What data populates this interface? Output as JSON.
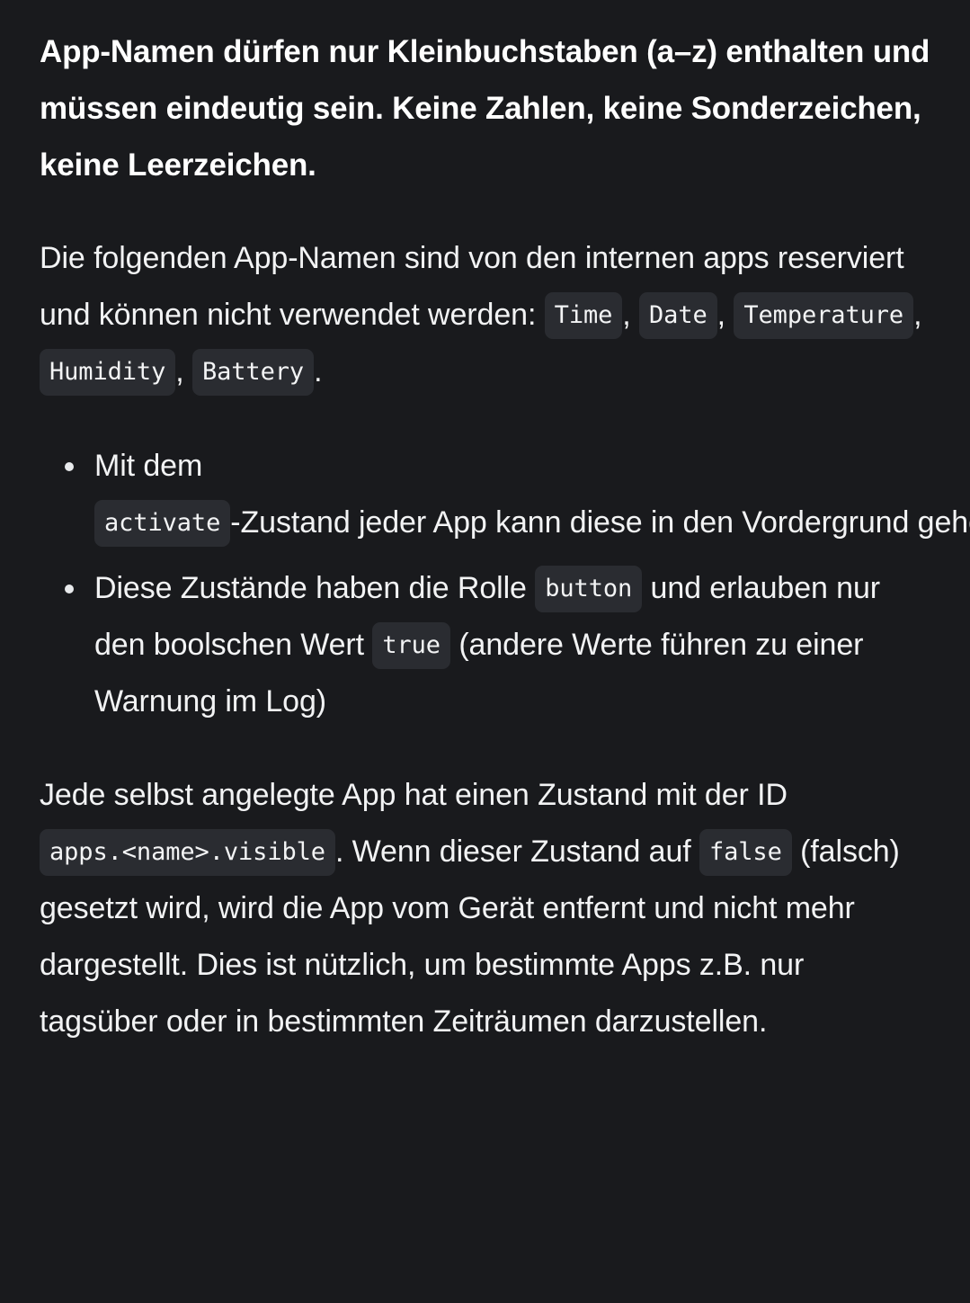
{
  "document": {
    "language": "de",
    "colors": {
      "background": "#191a1d",
      "text": "#f2f3f4",
      "heading_text": "#ffffff",
      "code_chip_background": "#2a2c31",
      "code_chip_text": "#f3f4f5",
      "bullet_marker": "#e8eaec"
    },
    "lead_paragraph": "App-Namen dürfen nur Kleinbuchstaben (a–z) enthalten und müssen eindeutig sein. Keine Zahlen, keine Sonderzeichen, keine Leerzeichen.",
    "reserved_paragraph": {
      "intro": "Die folgenden App-Namen sind von den internen apps reserviert und können nicht verwendet werden:",
      "reserved_names": [
        "Time",
        "Date",
        "Temperature",
        "Humidity",
        "Battery"
      ],
      "separator": ",",
      "terminator": "."
    },
    "bullets": [
      {
        "before_code": "Mit dem",
        "code": "activate",
        "after_code": "-Zustand jeder App kann diese in den Vordergrund geholt werden"
      },
      {
        "before_code": "Diese Zustände haben die Rolle",
        "code": "button",
        "middle_text": "und erlauben nur den boolschen Wert",
        "code2": "true",
        "after_code": "(andere Werte führen zu einer Warnung im Log)"
      }
    ],
    "visible_paragraph": {
      "part1": "Jede selbst angelegte App hat einen Zustand mit der ID",
      "code1": "apps.<name>.visible",
      "part2": ". Wenn dieser Zustand auf",
      "code2": "false",
      "part3": "(falsch) gesetzt wird, wird die App vom Gerät entfernt und nicht mehr dargestellt. Dies ist nützlich, um bestimmte Apps z.B. nur tagsüber oder in bestimmten Zeiträumen darzustellen."
    }
  }
}
